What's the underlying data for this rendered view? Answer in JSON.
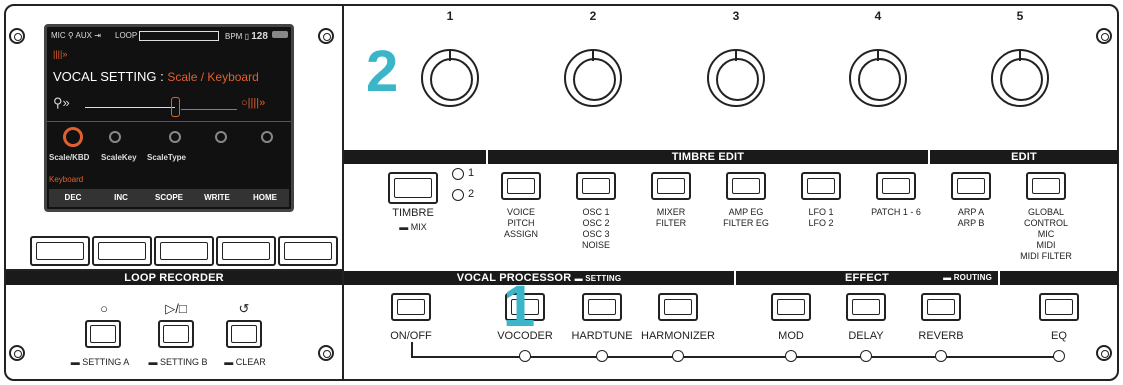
{
  "knob_numbers": [
    "1",
    "2",
    "3",
    "4",
    "5"
  ],
  "marker_big_2": "2",
  "marker_big_1": "1",
  "display": {
    "status": {
      "mic": "MIC",
      "aux": "AUX",
      "loop": "LOOP",
      "bpm": "BPM",
      "bpm_value": "128"
    },
    "title_prefix": "VOCAL SETTING : ",
    "title_value": "Scale / Keyboard",
    "params": [
      "Scale/KBD",
      "ScaleKey",
      "ScaleType"
    ],
    "param_value": "Keyboard",
    "softkeys": [
      "DEC",
      "INC",
      "SCOPE",
      "WRITE",
      "HOME"
    ]
  },
  "sections": {
    "timbre_edit": "TIMBRE EDIT",
    "edit": "EDIT",
    "loop_recorder": "LOOP RECORDER",
    "vocal_processor": "VOCAL PROCESSOR",
    "setting": "SETTING",
    "effect": "EFFECT",
    "routing": "ROUTING"
  },
  "timbre": {
    "label": "TIMBRE",
    "sub": "MIX",
    "led1": "1",
    "led2": "2"
  },
  "edit_buttons": [
    {
      "lines": [
        "VOICE",
        "PITCH",
        "ASSIGN"
      ]
    },
    {
      "lines": [
        "OSC 1",
        "OSC 2",
        "OSC 3",
        "NOISE"
      ]
    },
    {
      "lines": [
        "MIXER",
        "FILTER"
      ]
    },
    {
      "lines": [
        "AMP EG",
        "FILTER EG"
      ]
    },
    {
      "lines": [
        "LFO 1",
        "LFO 2"
      ]
    },
    {
      "lines": [
        "PATCH 1 - 6"
      ]
    },
    {
      "lines": [
        "ARP A",
        "ARP B"
      ]
    },
    {
      "lines": [
        "GLOBAL",
        "CONTROL",
        "MIC",
        "MIDI",
        "MIDI FILTER"
      ]
    }
  ],
  "loop": {
    "symbols": [
      "○",
      "▷/□",
      "↺"
    ],
    "labels": [
      "SETTING A",
      "SETTING B",
      "CLEAR"
    ]
  },
  "bottom_buttons": [
    "ON/OFF",
    "VOCODER",
    "HARDTUNE",
    "HARMONIZER",
    "MOD",
    "DELAY",
    "REVERB",
    "EQ"
  ]
}
